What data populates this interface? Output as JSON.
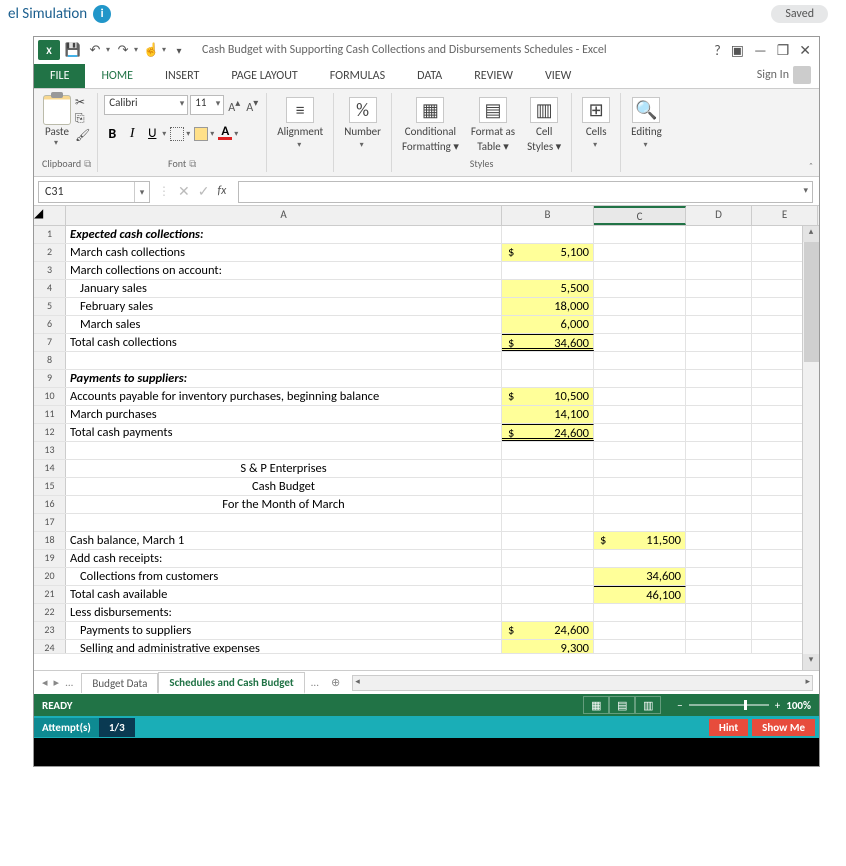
{
  "page": {
    "title": "el Simulation",
    "saved": "Saved"
  },
  "titlebar": {
    "doc": "Cash Budget with Supporting Cash Collections and Disbursements Schedules - Excel",
    "signin": "Sign In"
  },
  "tabs": {
    "file": "FILE",
    "home": "HOME",
    "insert": "INSERT",
    "page": "PAGE LAYOUT",
    "formulas": "FORMULAS",
    "data": "DATA",
    "review": "REVIEW",
    "view": "VIEW"
  },
  "ribbon": {
    "clipboard": "Clipboard",
    "paste": "Paste",
    "font": "Font",
    "fontname": "Calibri",
    "fontsize": "11",
    "alignment": "Alignment",
    "number": "Number",
    "cf": "Conditional",
    "cf2": "Formatting",
    "fat": "Format as",
    "fat2": "Table",
    "cs": "Cell",
    "cs2": "Styles",
    "styles": "Styles",
    "cells": "Cells",
    "editing": "Editing",
    "pct": "%"
  },
  "namebox": "C31",
  "cols": {
    "A": "A",
    "B": "B",
    "C": "C",
    "D": "D",
    "E": "E"
  },
  "rows": {
    "1": {
      "A": "Expected cash collections:"
    },
    "2": {
      "A": "March cash collections",
      "B": "5,100"
    },
    "3": {
      "A": "March collections on account:"
    },
    "4": {
      "A": "January sales",
      "B": "5,500"
    },
    "5": {
      "A": "February sales",
      "B": "18,000"
    },
    "6": {
      "A": "March sales",
      "B": "6,000"
    },
    "7": {
      "A": "Total cash collections",
      "B": "34,600"
    },
    "9": {
      "A": "Payments to suppliers:"
    },
    "10": {
      "A": "Accounts payable for inventory purchases, beginning balance",
      "B": "10,500"
    },
    "11": {
      "A": "March purchases",
      "B": "14,100"
    },
    "12": {
      "A": "Total cash payments",
      "B": "24,600"
    },
    "14": {
      "A": "S & P Enterprises"
    },
    "15": {
      "A": "Cash Budget"
    },
    "16": {
      "A": "For the Month of March"
    },
    "18": {
      "A": "Cash balance, March 1",
      "C": "11,500"
    },
    "19": {
      "A": "Add cash receipts:"
    },
    "20": {
      "A": "Collections from customers",
      "C": "34,600"
    },
    "21": {
      "A": "Total cash available",
      "C": "46,100"
    },
    "22": {
      "A": "Less disbursements:"
    },
    "23": {
      "A": "Payments to suppliers",
      "B": "24,600"
    },
    "24": {
      "A": "Selling and administrative expenses",
      "B": "9,300"
    }
  },
  "sheets": {
    "s1": "Budget Data",
    "s2": "Schedules and Cash Budget",
    "more": "...",
    "add": "⊕"
  },
  "status": {
    "ready": "READY",
    "zoom": "100%"
  },
  "attempts": {
    "label": "Attempt(s)",
    "value": "1/3",
    "hint": "Hint",
    "show": "Show Me"
  }
}
